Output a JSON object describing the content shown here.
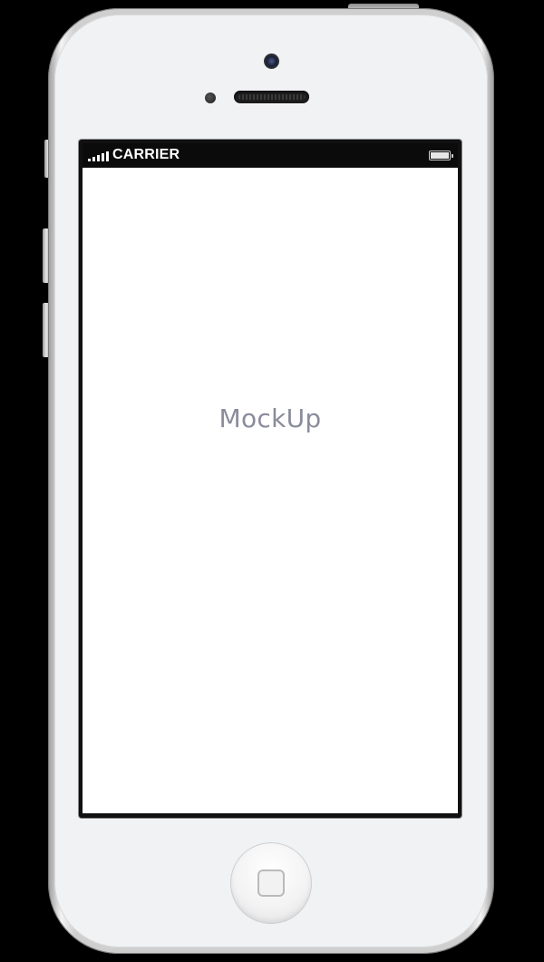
{
  "status_bar": {
    "carrier_label": "CARRIER",
    "signal_icon": "signal-bars-icon",
    "battery_icon": "battery-icon",
    "battery_level": 1.0
  },
  "screen": {
    "center_text": "MockUp",
    "background_color": "#ffffff",
    "text_color": "#8a8c9a"
  },
  "device": {
    "body_color": "#f1f2f4",
    "home_button_icon": "home-square-icon"
  }
}
